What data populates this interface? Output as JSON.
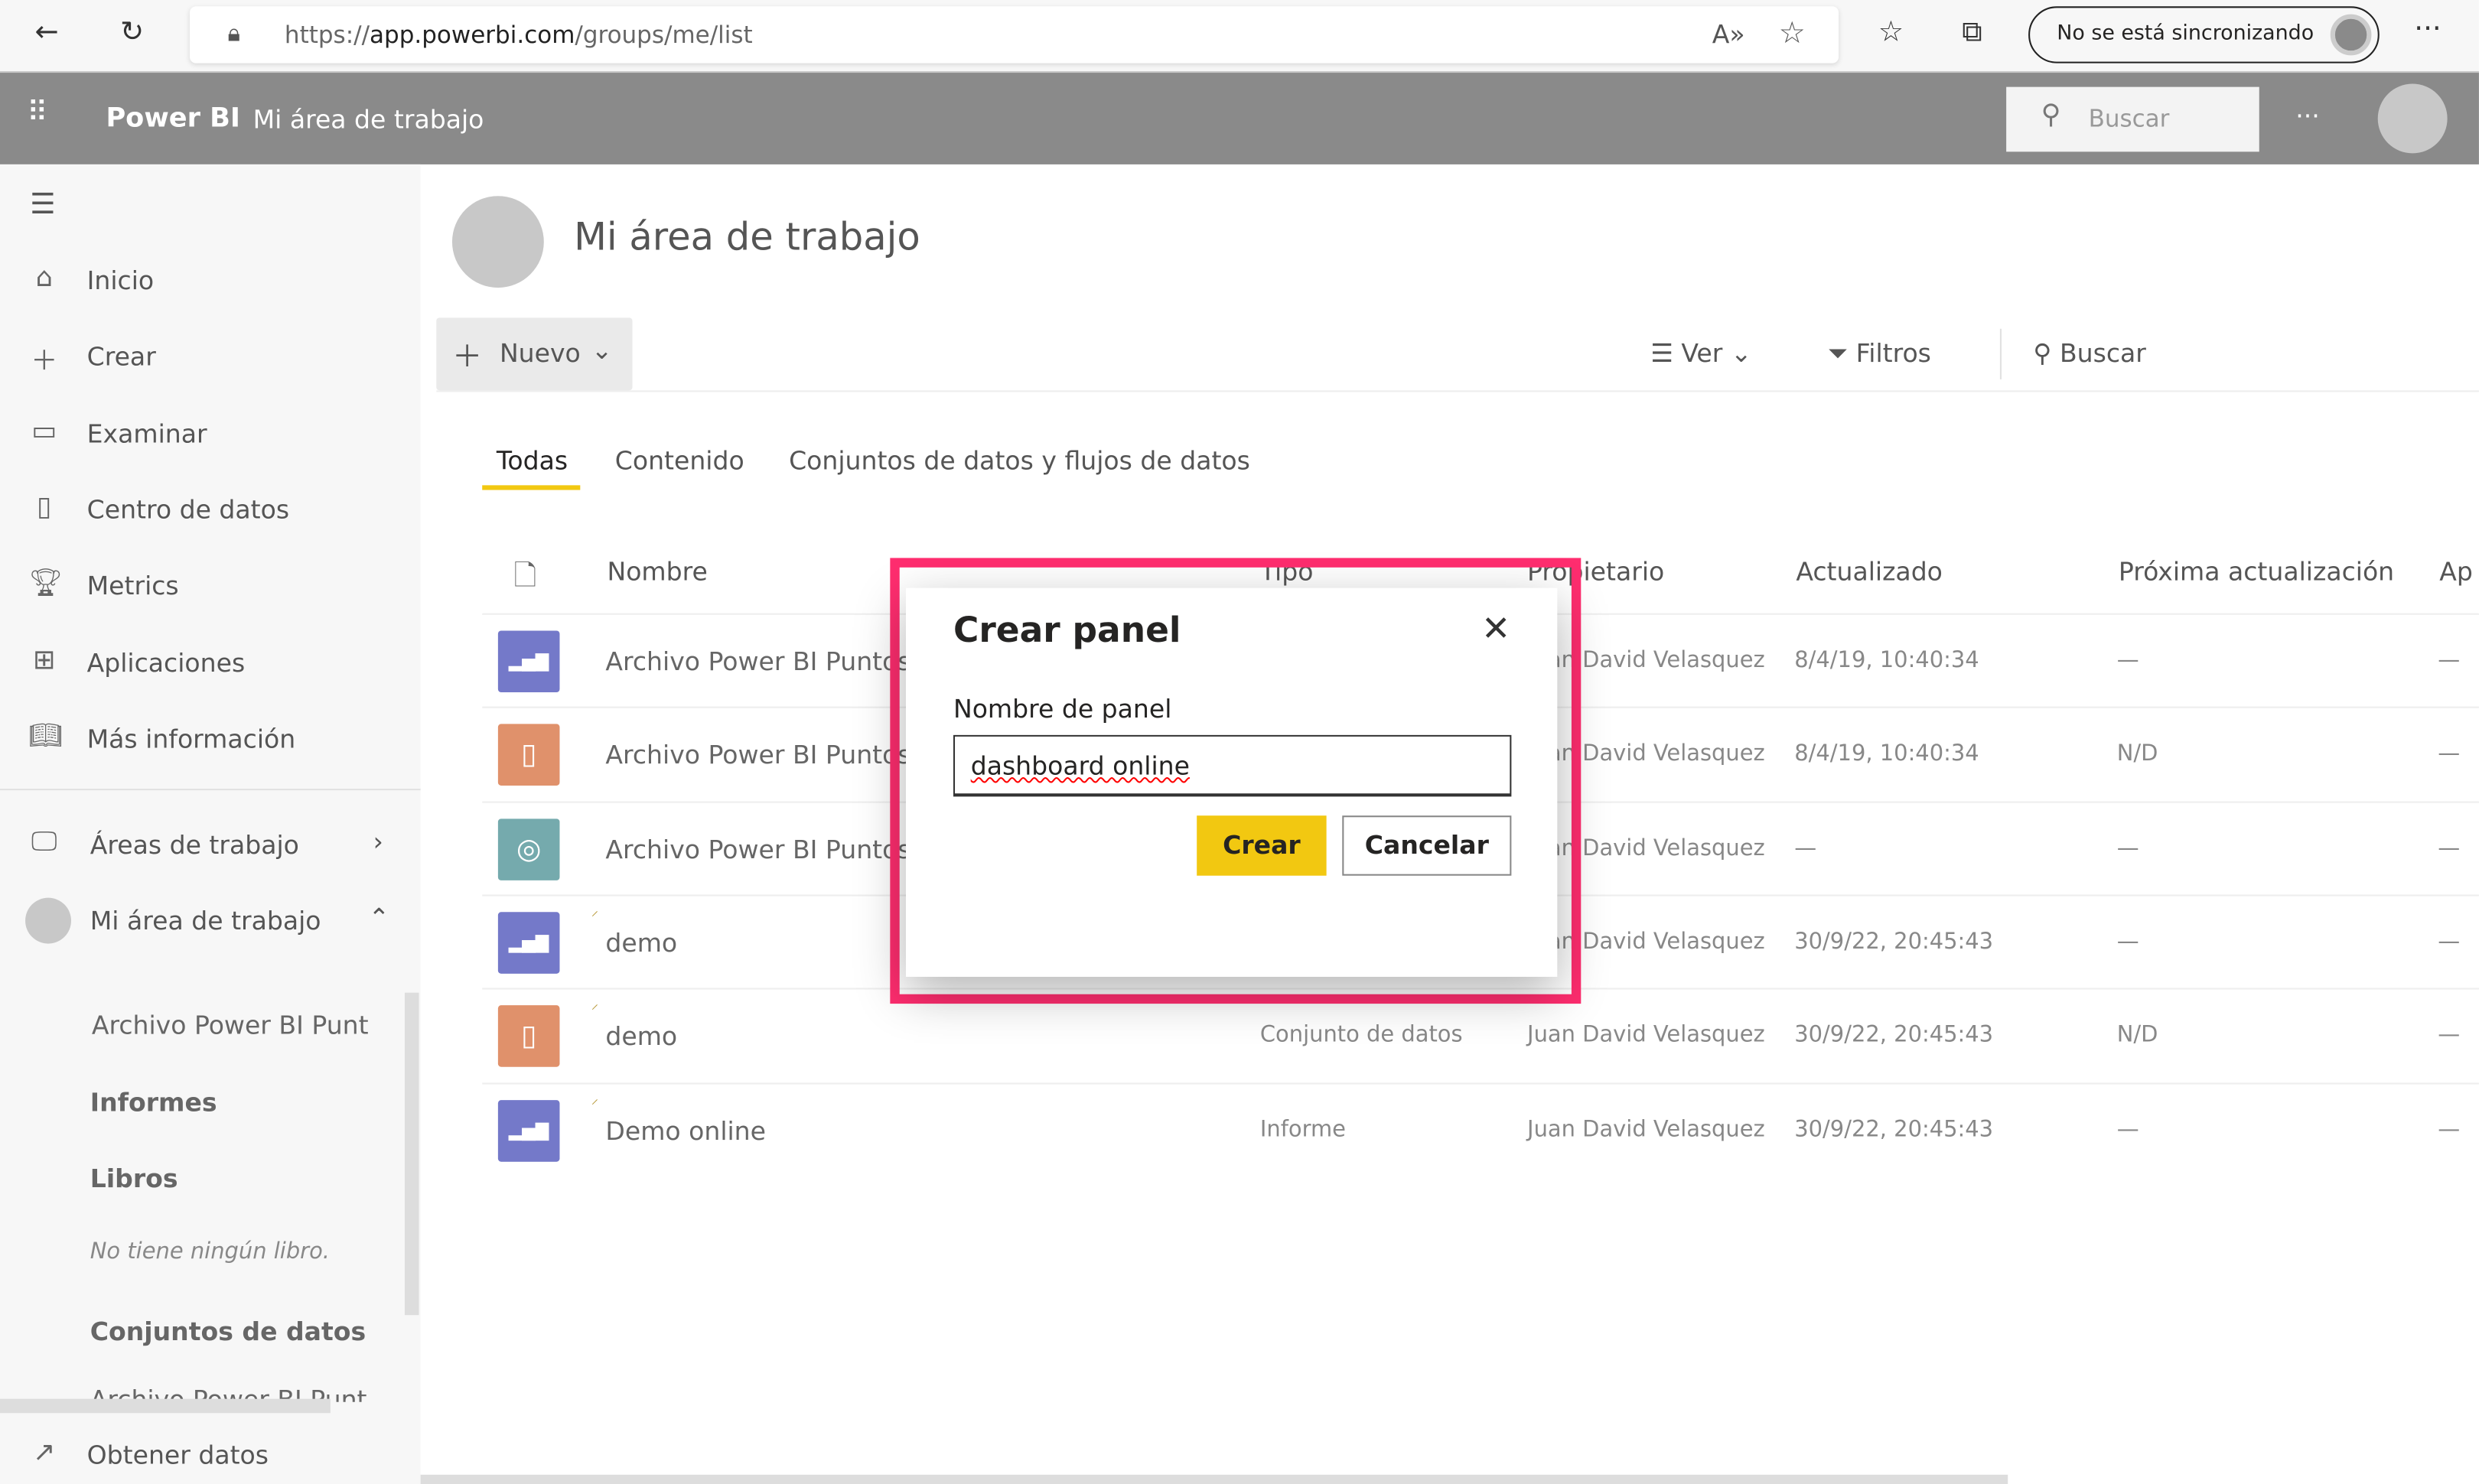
{
  "browser": {
    "url_prefix": "https://",
    "url_host": "app.powerbi.com",
    "url_path": "/groups/me/list",
    "sync_label": "No se está sincronizando"
  },
  "header": {
    "app_name": "Power BI",
    "workspace": "Mi área de trabajo",
    "search_placeholder": "Buscar",
    "more": "···"
  },
  "sidebar": {
    "items": [
      {
        "label": "Inicio",
        "icon": "home-icon"
      },
      {
        "label": "Crear",
        "icon": "plus-icon"
      },
      {
        "label": "Examinar",
        "icon": "folder-icon"
      },
      {
        "label": "Centro de datos",
        "icon": "database-icon"
      },
      {
        "label": "Metrics",
        "icon": "trophy-icon"
      },
      {
        "label": "Aplicaciones",
        "icon": "apps-icon"
      },
      {
        "label": "Más información",
        "icon": "book-icon"
      }
    ],
    "workspaces": "Áreas de trabajo",
    "my_workspace": "Mi área de trabajo",
    "sub_items": {
      "file": "Archivo Power BI Punt",
      "reports": "Informes",
      "workbooks": "Libros",
      "no_workbooks": "No tiene ningún libro.",
      "datasets": "Conjuntos de datos",
      "dataset_file": "Archivo Power BI Punt"
    },
    "get_data": "Obtener datos"
  },
  "main": {
    "title": "Mi área de trabajo",
    "new_label": "Nuevo",
    "view_label": "Ver",
    "filters_label": "Filtros",
    "search_label": "Buscar",
    "tabs": [
      "Todas",
      "Contenido",
      "Conjuntos de datos y flujos de datos"
    ],
    "columns": [
      "Nombre",
      "Tipo",
      "Propietario",
      "Actualizado",
      "Próxima actualización",
      "Ap"
    ],
    "rows": [
      {
        "name": "Archivo Power BI Puntos",
        "type": "",
        "owner": "Juan David Velasquez",
        "updated": "8/4/19, 10:40:34",
        "next": "—",
        "ap": "—",
        "kind": "report",
        "color": "#7479c9"
      },
      {
        "name": "Archivo Power BI Puntos",
        "type": "",
        "owner": "Juan David Velasquez",
        "updated": "8/4/19, 10:40:34",
        "next": "N/D",
        "ap": "—",
        "kind": "dataset",
        "color": "#e0916b"
      },
      {
        "name": "Archivo Power BI Puntos",
        "type": "",
        "owner": "Juan David Velasquez",
        "updated": "—",
        "next": "—",
        "ap": "—",
        "kind": "dashboard",
        "color": "#75aaad"
      },
      {
        "name": "demo",
        "type": "",
        "owner": "Juan David Velasquez",
        "updated": "30/9/22, 20:45:43",
        "next": "—",
        "ap": "—",
        "kind": "report",
        "color": "#7479c9"
      },
      {
        "name": "demo",
        "type": "Conjunto de datos",
        "owner": "Juan David Velasquez",
        "updated": "30/9/22, 20:45:43",
        "next": "N/D",
        "ap": "—",
        "kind": "dataset",
        "color": "#e0916b"
      },
      {
        "name": "Demo online",
        "type": "Informe",
        "owner": "Juan David Velasquez",
        "updated": "30/9/22, 20:45:43",
        "next": "—",
        "ap": "—",
        "kind": "report",
        "color": "#7479c9"
      }
    ]
  },
  "dialog": {
    "title": "Crear panel",
    "field_label": "Nombre de panel",
    "field_value": "dashboard online",
    "create": "Crear",
    "cancel": "Cancelar",
    "highlight_color": "#ff2d6f",
    "create_color": "#f2c811"
  }
}
